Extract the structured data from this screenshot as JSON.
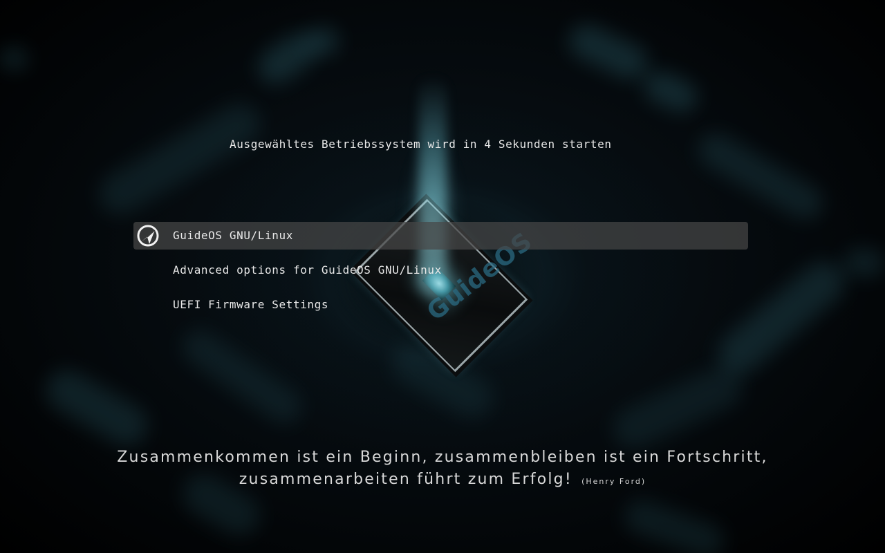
{
  "countdown_text": "Ausgewähltes Betriebssystem wird in 4 Sekunden starten",
  "background": {
    "chip_brand": "GuideOS",
    "accent_color": "#6fc3d2"
  },
  "menu": {
    "selected_index": 0,
    "items": [
      {
        "label": "GuideOS GNU/Linux",
        "icon": "guideos-logo-icon"
      },
      {
        "label": "Advanced options for GuideOS GNU/Linux"
      },
      {
        "label": "UEFI Firmware Settings"
      }
    ]
  },
  "quote": {
    "line1": "Zusammenkommen ist ein Beginn, zusammenbleiben ist ein Fortschritt,",
    "line2": "zusammenarbeiten führt zum Erfolg!",
    "author": "(Henry Ford)"
  }
}
